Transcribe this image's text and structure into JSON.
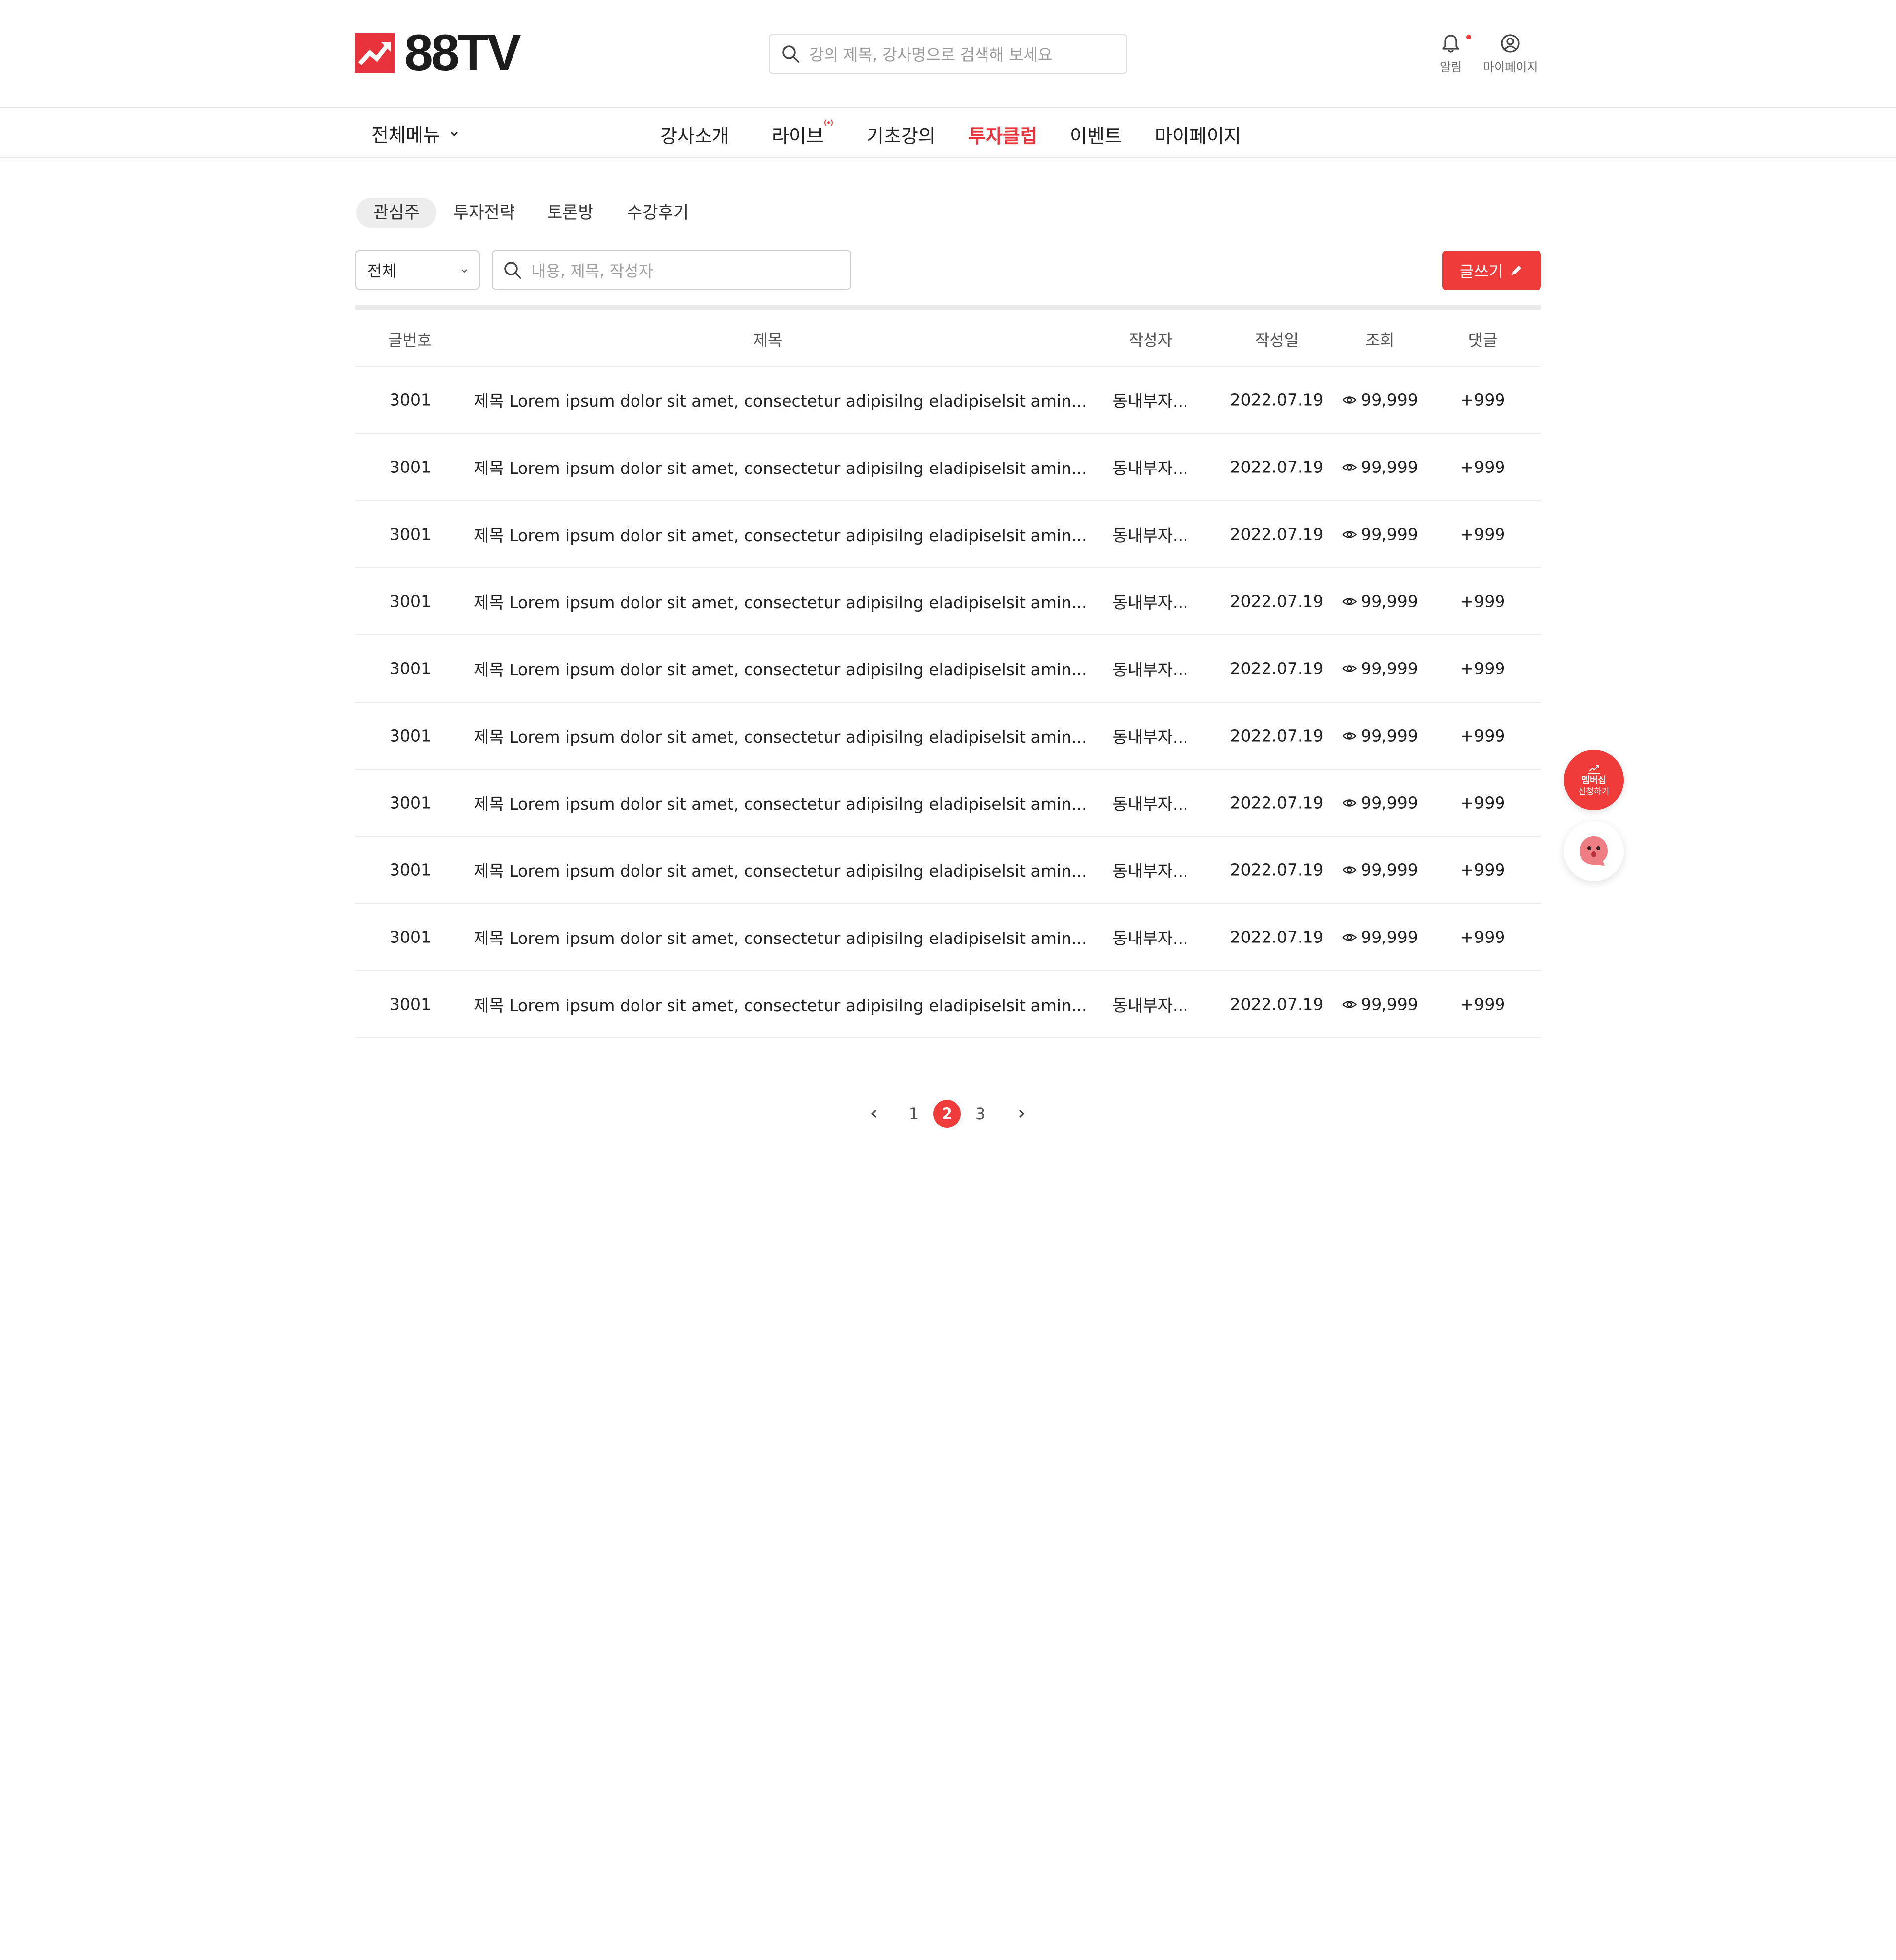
{
  "header": {
    "logo_text": "88TV",
    "search_placeholder": "강의 제목, 강사명으로 검색해 보세요",
    "icons": [
      {
        "icon": "bell-icon",
        "label": "알림"
      },
      {
        "icon": "user-circle-icon",
        "label": "마이페이지"
      }
    ]
  },
  "nav": {
    "all_menu": "전체메뉴",
    "items": [
      "강사소개",
      "라이브",
      "기초강의",
      "투자클럽",
      "이벤트",
      "마이페이지"
    ],
    "active": "투자클럽",
    "live_badge_icon": "live-broadcast-icon"
  },
  "tabs": {
    "items": [
      "관심주",
      "투자전략",
      "토론방",
      "수강후기"
    ],
    "active": "관심주"
  },
  "filter": {
    "select_value": "전체",
    "search_placeholder": "내용, 제목, 작성자",
    "write_button": "글쓰기"
  },
  "table": {
    "columns": [
      "글번호",
      "제목",
      "작성자",
      "작성일",
      "조회",
      "댓글"
    ],
    "rows": [
      {
        "no": "3001",
        "title": "제목 Lorem ipsum dolor sit amet, consectetur adipisilng eladipiselsit amin...",
        "author": "동내부자...",
        "date": "2022.07.19",
        "views": "99,999",
        "comments": "+999"
      },
      {
        "no": "3001",
        "title": "제목 Lorem ipsum dolor sit amet, consectetur adipisilng eladipiselsit amin...",
        "author": "동내부자...",
        "date": "2022.07.19",
        "views": "99,999",
        "comments": "+999"
      },
      {
        "no": "3001",
        "title": "제목 Lorem ipsum dolor sit amet, consectetur adipisilng eladipiselsit amin...",
        "author": "동내부자...",
        "date": "2022.07.19",
        "views": "99,999",
        "comments": "+999"
      },
      {
        "no": "3001",
        "title": "제목 Lorem ipsum dolor sit amet, consectetur adipisilng eladipiselsit amin...",
        "author": "동내부자...",
        "date": "2022.07.19",
        "views": "99,999",
        "comments": "+999"
      },
      {
        "no": "3001",
        "title": "제목 Lorem ipsum dolor sit amet, consectetur adipisilng eladipiselsit amin...",
        "author": "동내부자...",
        "date": "2022.07.19",
        "views": "99,999",
        "comments": "+999"
      },
      {
        "no": "3001",
        "title": "제목 Lorem ipsum dolor sit amet, consectetur adipisilng eladipiselsit amin...",
        "author": "동내부자...",
        "date": "2022.07.19",
        "views": "99,999",
        "comments": "+999"
      },
      {
        "no": "3001",
        "title": "제목 Lorem ipsum dolor sit amet, consectetur adipisilng eladipiselsit amin...",
        "author": "동내부자...",
        "date": "2022.07.19",
        "views": "99,999",
        "comments": "+999"
      },
      {
        "no": "3001",
        "title": "제목 Lorem ipsum dolor sit amet, consectetur adipisilng eladipiselsit amin...",
        "author": "동내부자...",
        "date": "2022.07.19",
        "views": "99,999",
        "comments": "+999"
      },
      {
        "no": "3001",
        "title": "제목 Lorem ipsum dolor sit amet, consectetur adipisilng eladipiselsit amin...",
        "author": "동내부자...",
        "date": "2022.07.19",
        "views": "99,999",
        "comments": "+999"
      },
      {
        "no": "3001",
        "title": "제목 Lorem ipsum dolor sit amet, consectetur adipisilng eladipiselsit amin...",
        "author": "동내부자...",
        "date": "2022.07.19",
        "views": "99,999",
        "comments": "+999"
      }
    ]
  },
  "pagination": {
    "pages": [
      "1",
      "2",
      "3"
    ],
    "current": "2"
  },
  "floating": {
    "membership_line1": "멤버십",
    "membership_line2": "신청하기"
  },
  "colors": {
    "accent": "#f03b3b",
    "logo_red": "#e8333c",
    "text": "#222222",
    "border": "#eaeaea"
  }
}
